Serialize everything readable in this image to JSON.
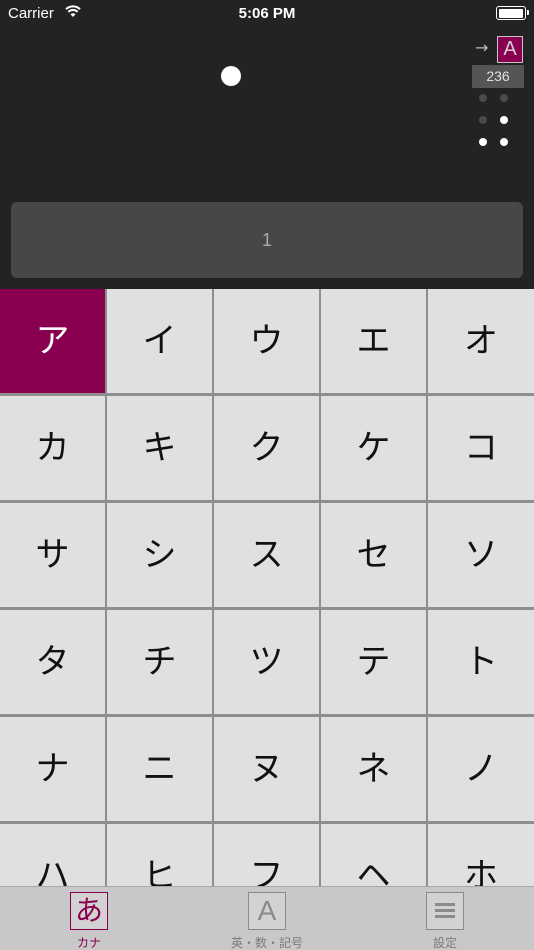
{
  "status_bar": {
    "carrier": "Carrier",
    "time": "5:06 PM",
    "battery_level": 1.0
  },
  "indicator": {
    "arrow": "→",
    "mode_letter": "A",
    "count": "236",
    "braille_dots": [
      false,
      false,
      true,
      false,
      true,
      true
    ]
  },
  "display": {
    "text": "1"
  },
  "keypad": {
    "selected_index": 0,
    "keys": [
      "ア",
      "イ",
      "ウ",
      "エ",
      "オ",
      "カ",
      "キ",
      "ク",
      "ケ",
      "コ",
      "サ",
      "シ",
      "ス",
      "セ",
      "ソ",
      "タ",
      "チ",
      "ツ",
      "テ",
      "ト",
      "ナ",
      "ニ",
      "ヌ",
      "ネ",
      "ノ",
      "ハ",
      "ヒ",
      "フ",
      "ヘ",
      "ホ"
    ]
  },
  "tab_bar": {
    "tabs": [
      {
        "label": "カナ",
        "glyph": "あ",
        "icon": "hiragana-a-icon",
        "active": true
      },
      {
        "label": "英・数・記号",
        "glyph": "A",
        "icon": "letter-a-icon",
        "active": false
      },
      {
        "label": "設定",
        "glyph": "",
        "icon": "menu-icon",
        "active": false
      }
    ]
  },
  "colors": {
    "accent": "#8a0050",
    "background": "#232323",
    "key_background": "#e0e0e0"
  }
}
